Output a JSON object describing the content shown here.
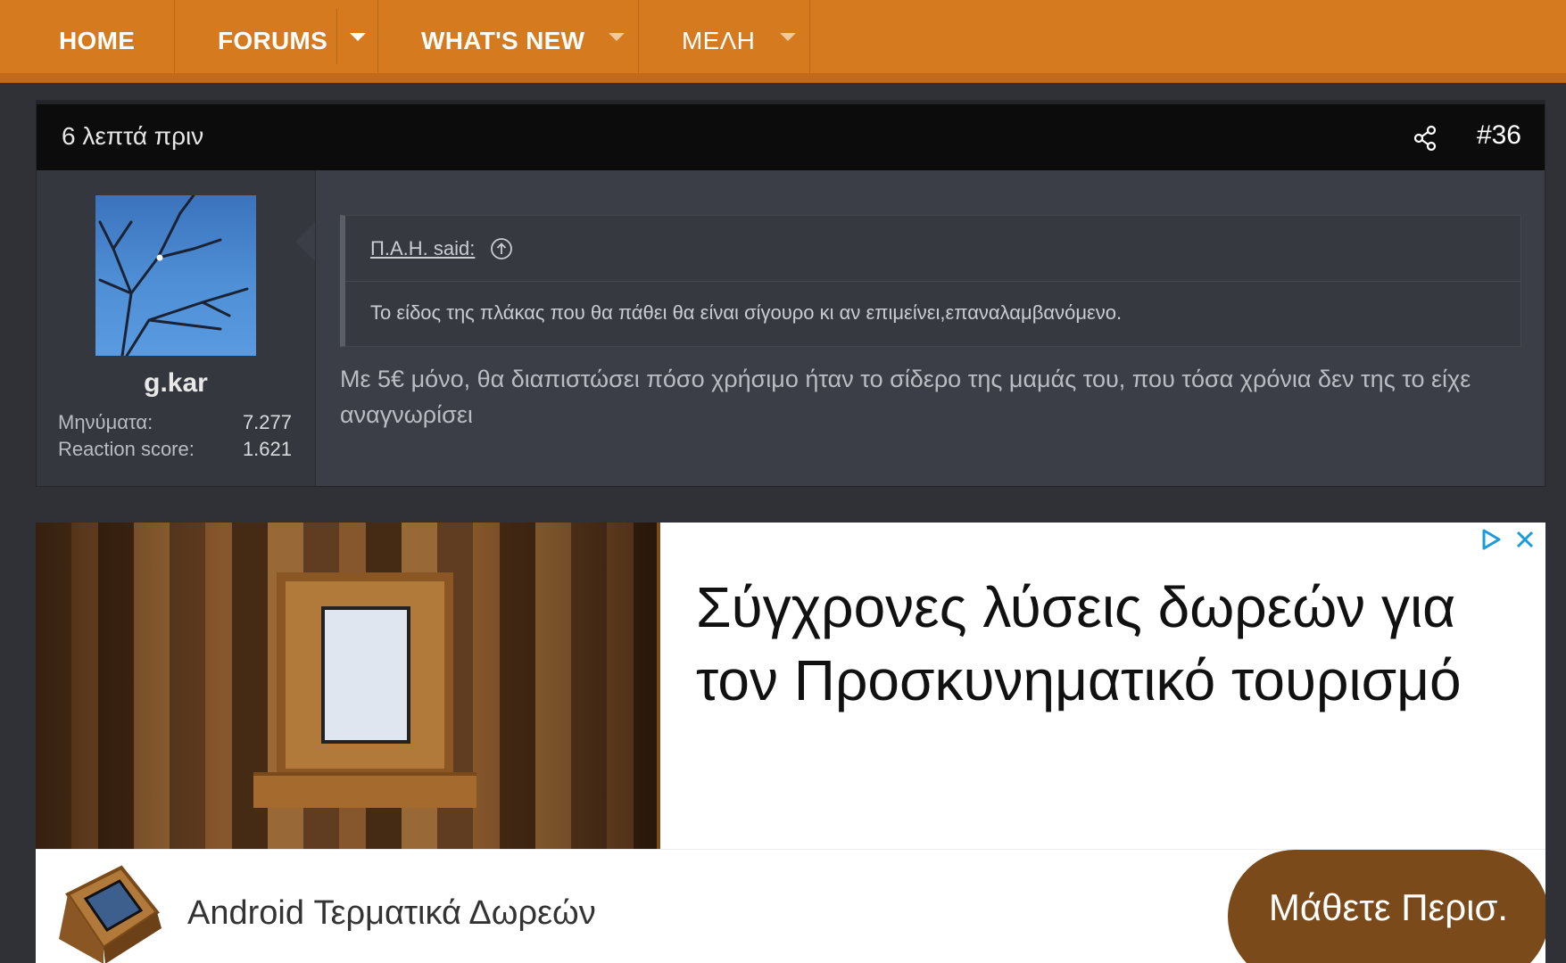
{
  "nav": {
    "home": "HOME",
    "forums": "FORUMS",
    "whats_new": "WHAT'S NEW",
    "members": "ΜΕΛΗ"
  },
  "post": {
    "time": "6 λεπτά πριν",
    "number": "#36",
    "user": {
      "name": "g.kar",
      "messages_label": "Μηνύματα:",
      "messages_value": "7.277",
      "reaction_label": "Reaction score:",
      "reaction_value": "1.621"
    },
    "quote": {
      "author": "Π.Α.Η. said:",
      "text": "Το είδος της πλάκας που θα πάθει θα είναι σίγουρο κι αν επιμείνει,επαναλαμβανόμενο."
    },
    "body": "Με 5€ μόνο, θα διαπιστώσει πόσο χρήσιμο ήταν το σίδερο της μαμάς του, που τόσα χρόνια δεν της το είχε αναγνωρίσει"
  },
  "ad": {
    "headline": "Σύγχρονες λύσεις δωρεών για τον Προσκυνηματικό τουρισμό",
    "brand": "Android Τερματικά Δωρεών",
    "cta": "Μάθετε Περισ."
  },
  "colors": {
    "nav": "#d67a1f",
    "page_bg": "#2f3137",
    "post_bg": "#3b3e46",
    "cta_bg": "#7a4a1a"
  }
}
